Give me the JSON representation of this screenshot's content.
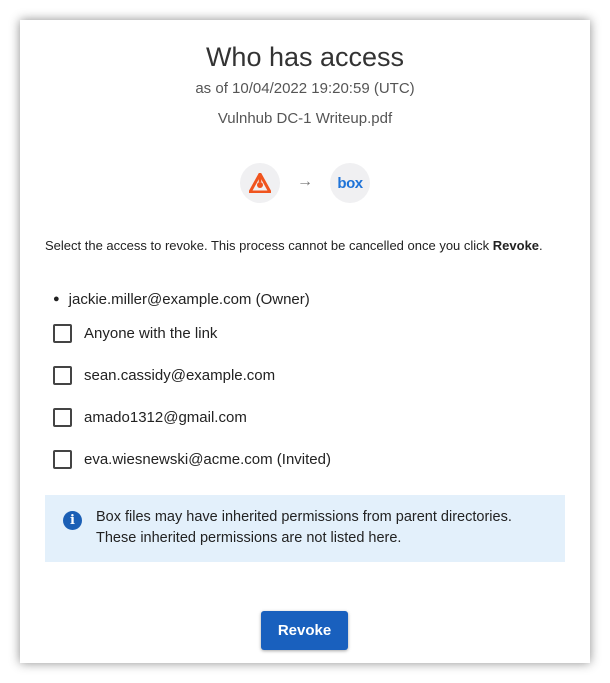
{
  "dialog": {
    "title": "Who has access",
    "subtitle": "as of 10/04/2022 19:20:59 (UTC)",
    "filename": "Vulnhub DC-1 Writeup.pdf",
    "source_icon": "source-app-logo-icon",
    "destination_logo_text": "box",
    "arrow": "→",
    "instructions_prefix": "Select the access to revoke. This process cannot be cancelled once you click ",
    "instructions_bold": "Revoke",
    "instructions_suffix": ".",
    "owner": "jackie.miller@example.com (Owner)",
    "options": [
      {
        "label": "Anyone with the link",
        "checked": false
      },
      {
        "label": "sean.cassidy@example.com",
        "checked": false
      },
      {
        "label": "amado1312@gmail.com",
        "checked": false
      },
      {
        "label": "eva.wiesnewski@acme.com (Invited)",
        "checked": false
      }
    ],
    "notice": "Box files may have inherited permissions from parent directories. These inherited permissions are not listed here.",
    "revoke_label": "Revoke"
  },
  "colors": {
    "primary": "#1960be",
    "notice_bg": "#e3f0fb",
    "source_logo": "#f0541e",
    "box_brand": "#1e73d8"
  }
}
